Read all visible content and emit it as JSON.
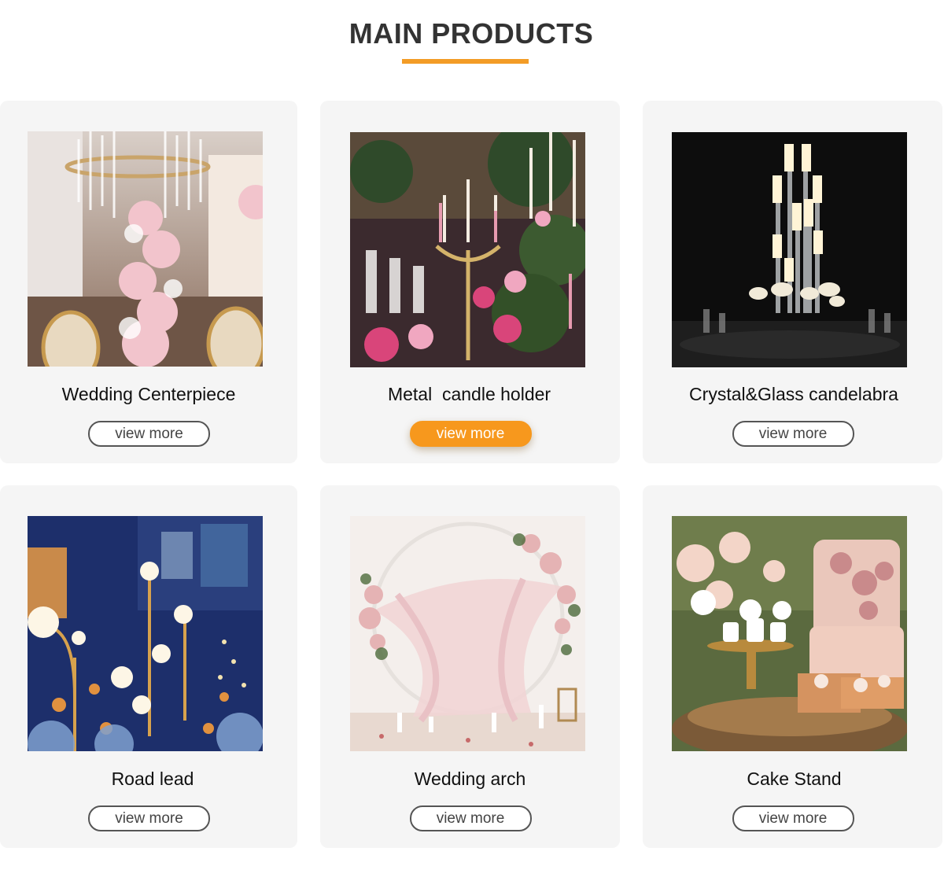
{
  "section": {
    "title": "MAIN PRODUCTS",
    "accent_color": "#f39c26"
  },
  "products": [
    {
      "name": "Wedding Centerpiece",
      "button": "view more",
      "image": "wedding-centerpiece-photo"
    },
    {
      "name": "Metal  candle holder",
      "button": "view more",
      "image": "metal-candle-holder-photo"
    },
    {
      "name": "Crystal&Glass candelabra",
      "button": "view more",
      "image": "crystal-glass-candelabra-photo"
    },
    {
      "name": "Road lead",
      "button": "view more",
      "image": "road-lead-photo"
    },
    {
      "name": "Wedding arch",
      "button": "view more",
      "image": "wedding-arch-photo"
    },
    {
      "name": "Cake Stand",
      "button": "view more",
      "image": "cake-stand-photo"
    }
  ]
}
